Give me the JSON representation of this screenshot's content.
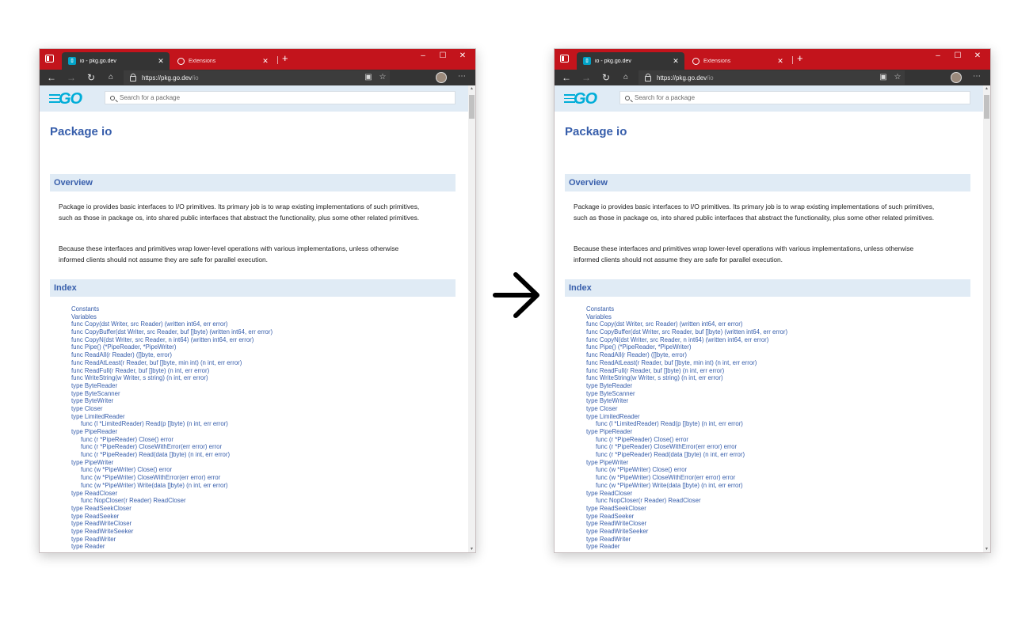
{
  "browser": {
    "tabs": [
      {
        "label": "io - pkg.go.dev",
        "active": true
      },
      {
        "label": "Extensions",
        "active": false
      }
    ],
    "url_host": "https://pkg.go.dev",
    "url_path": "/io",
    "window_controls": {
      "minimize": "–",
      "maximize": "☐",
      "close": "✕"
    },
    "nav_icons": [
      "back-icon",
      "forward-icon",
      "refresh-icon",
      "home-icon"
    ],
    "accent_color": "#c3141c"
  },
  "site": {
    "logo": "GO",
    "search_placeholder": "Search for a package",
    "page_title": "Package io"
  },
  "overview": {
    "heading": "Overview",
    "para1": "Package io provides basic interfaces to I/O primitives. Its primary job is to wrap existing implementations of such primitives, such as those in package os, into shared public interfaces that abstract the functionality, plus some other related primitives.",
    "para2": "Because these interfaces and primitives wrap lower-level operations with various implementations, unless otherwise informed clients should not assume they are safe for parallel execution."
  },
  "index": {
    "heading": "Index",
    "items": [
      {
        "text": "Constants",
        "indent": 0
      },
      {
        "text": "Variables",
        "indent": 0
      },
      {
        "text": "func Copy(dst Writer, src Reader) (written int64, err error)",
        "indent": 0
      },
      {
        "text": "func CopyBuffer(dst Writer, src Reader, buf []byte) (written int64, err error)",
        "indent": 0
      },
      {
        "text": "func CopyN(dst Writer, src Reader, n int64) (written int64, err error)",
        "indent": 0
      },
      {
        "text": "func Pipe() (*PipeReader, *PipeWriter)",
        "indent": 0
      },
      {
        "text": "func ReadAll(r Reader) ([]byte, error)",
        "indent": 0
      },
      {
        "text": "func ReadAtLeast(r Reader, buf []byte, min int) (n int, err error)",
        "indent": 0
      },
      {
        "text": "func ReadFull(r Reader, buf []byte) (n int, err error)",
        "indent": 0
      },
      {
        "text": "func WriteString(w Writer, s string) (n int, err error)",
        "indent": 0
      },
      {
        "text": "type ByteReader",
        "indent": 0
      },
      {
        "text": "type ByteScanner",
        "indent": 0
      },
      {
        "text": "type ByteWriter",
        "indent": 0
      },
      {
        "text": "type Closer",
        "indent": 0
      },
      {
        "text": "type LimitedReader",
        "indent": 0
      },
      {
        "text": "func (l *LimitedReader) Read(p []byte) (n int, err error)",
        "indent": 1
      },
      {
        "text": "type PipeReader",
        "indent": 0
      },
      {
        "text": "func (r *PipeReader) Close() error",
        "indent": 1
      },
      {
        "text": "func (r *PipeReader) CloseWithError(err error) error",
        "indent": 1
      },
      {
        "text": "func (r *PipeReader) Read(data []byte) (n int, err error)",
        "indent": 1
      },
      {
        "text": "type PipeWriter",
        "indent": 0
      },
      {
        "text": "func (w *PipeWriter) Close() error",
        "indent": 1
      },
      {
        "text": "func (w *PipeWriter) CloseWithError(err error) error",
        "indent": 1
      },
      {
        "text": "func (w *PipeWriter) Write(data []byte) (n int, err error)",
        "indent": 1
      },
      {
        "text": "type ReadCloser",
        "indent": 0
      },
      {
        "text": "func NopCloser(r Reader) ReadCloser",
        "indent": 1
      },
      {
        "text": "type ReadSeekCloser",
        "indent": 0
      },
      {
        "text": "type ReadSeeker",
        "indent": 0
      },
      {
        "text": "type ReadWriteCloser",
        "indent": 0
      },
      {
        "text": "type ReadWriteSeeker",
        "indent": 0
      },
      {
        "text": "type ReadWriter",
        "indent": 0
      },
      {
        "text": "type Reader",
        "indent": 0
      }
    ]
  },
  "transition_icon": "right-arrow-icon"
}
